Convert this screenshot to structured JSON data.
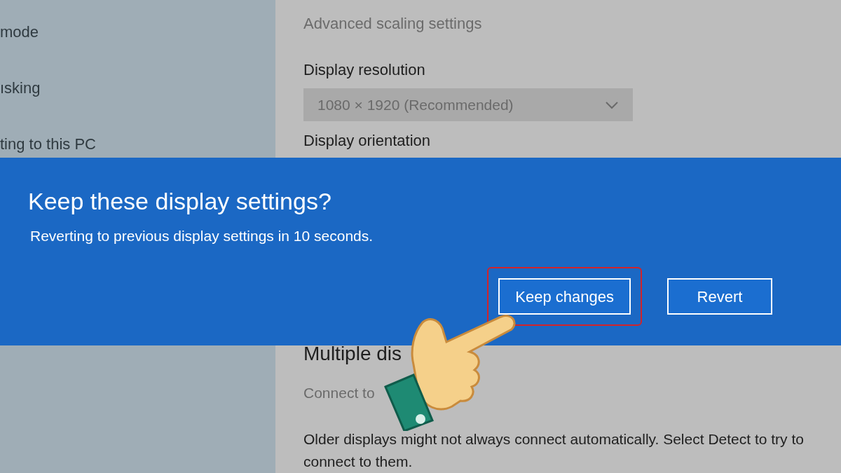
{
  "sidebar": {
    "items": [
      {
        "label": "mode"
      },
      {
        "label": "ısking"
      },
      {
        "label": "ting to this PC"
      }
    ]
  },
  "settings": {
    "link": "Advanced scaling settings",
    "resolution_label": "Display resolution",
    "resolution_value": "1080 × 1920 (Recommended)",
    "orientation_label": "Display orientation",
    "multiple_heading": "Multiple dis",
    "connect_text": "Connect to",
    "older_text": "Older displays might not always connect automatically. Select Detect to try to connect to them."
  },
  "dialog": {
    "title": "Keep these display settings?",
    "message": "Reverting to previous display settings in 10 seconds.",
    "buttons": [
      {
        "label": "Keep changes",
        "highlighted": true
      },
      {
        "label": "Revert",
        "highlighted": false
      }
    ]
  }
}
